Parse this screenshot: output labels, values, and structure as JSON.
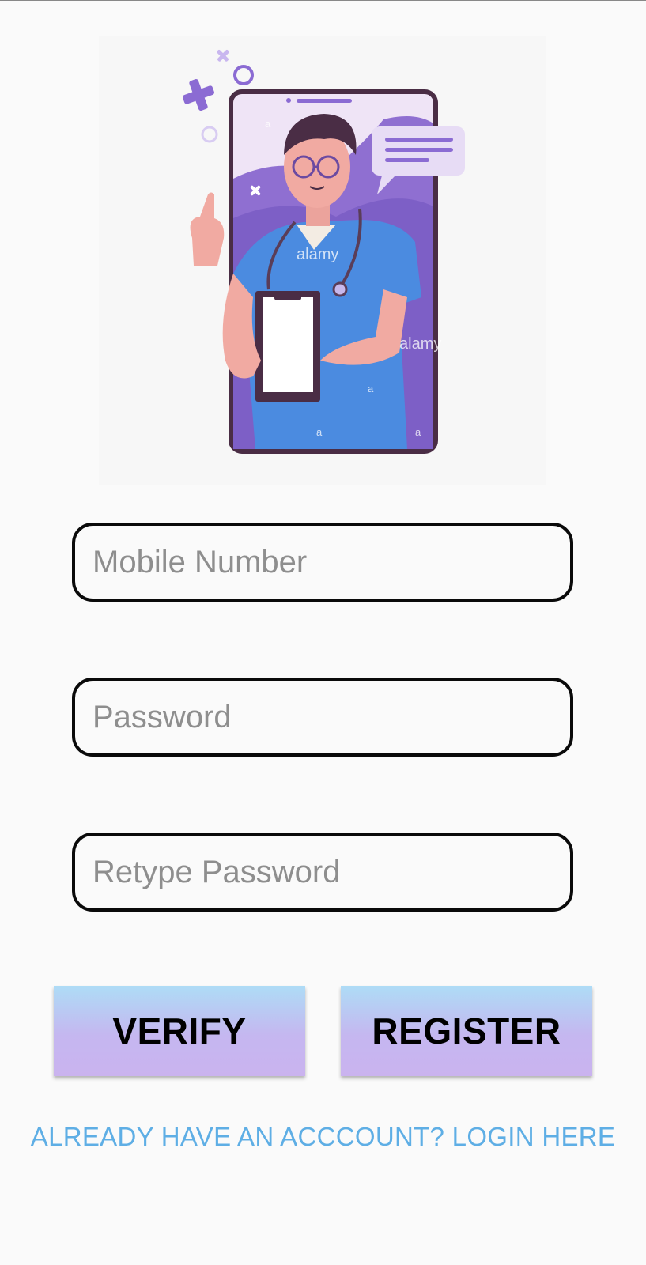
{
  "hero": {
    "watermark_brand": "alamy",
    "watermark_letter": "a"
  },
  "form": {
    "mobile": {
      "placeholder": "Mobile Number",
      "value": ""
    },
    "password": {
      "placeholder": "Password",
      "value": ""
    },
    "retype_password": {
      "placeholder": "Retype Password",
      "value": ""
    }
  },
  "buttons": {
    "verify": "VERIFY",
    "register": "REGISTER"
  },
  "login_link": "ALREADY HAVE AN ACCCOUNT? LOGIN HERE",
  "colors": {
    "background": "#fafafa",
    "button_gradient_top": "#aedcf6",
    "button_gradient_bottom": "#cab3ef",
    "link": "#5eaee5",
    "field_border": "#0a0a0a",
    "placeholder": "#8e8e8e"
  }
}
